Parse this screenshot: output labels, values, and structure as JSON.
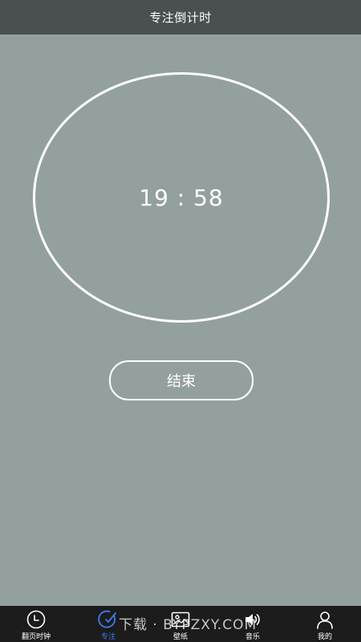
{
  "header": {
    "title": "专注倒计时"
  },
  "timer": {
    "display": "19 : 58"
  },
  "actions": {
    "end_label": "结束"
  },
  "tabbar": {
    "items": [
      {
        "label": "翻页时钟",
        "icon": "clock-icon"
      },
      {
        "label": "专注",
        "icon": "focus-icon",
        "active": true
      },
      {
        "label": "壁纸",
        "icon": "image-icon"
      },
      {
        "label": "音乐",
        "icon": "speaker-icon"
      },
      {
        "label": "我的",
        "icon": "user-icon"
      }
    ]
  },
  "watermark": {
    "text": "下载 · BYPZXY.COM"
  },
  "colors": {
    "background": "#94a09f",
    "header": "#4a4f52",
    "tabbar": "#1c1c1c",
    "active_tab": "#3d7df0",
    "foreground": "#ffffff"
  }
}
